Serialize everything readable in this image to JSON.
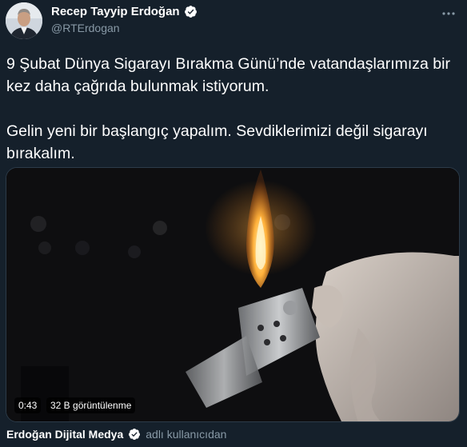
{
  "author": {
    "name": "Recep Tayyip Erdoğan",
    "handle": "@RTErdogan",
    "avatar_icon": "profile-photo",
    "verified_icon": "verified-badge-icon"
  },
  "tweet": {
    "paragraphs": [
      "9 Şubat Dünya Sigarayı Bırakma Günü’nde vatandaşlarımıza bir kez daha çağrıda bulunmak istiyorum.",
      "Gelin yeni bir başlangıç yapalım. Sevdiklerimizi değil sigarayı bırakalım."
    ]
  },
  "media": {
    "duration": "0:43",
    "views": "32 B görüntülenme"
  },
  "source": {
    "name": "Erdoğan Dijital Medya",
    "suffix": "adlı kullanıcıdan"
  },
  "colors": {
    "background": "#15202b",
    "text": "#ffffff",
    "secondary": "#8899a6",
    "verified": "#ffffff"
  }
}
